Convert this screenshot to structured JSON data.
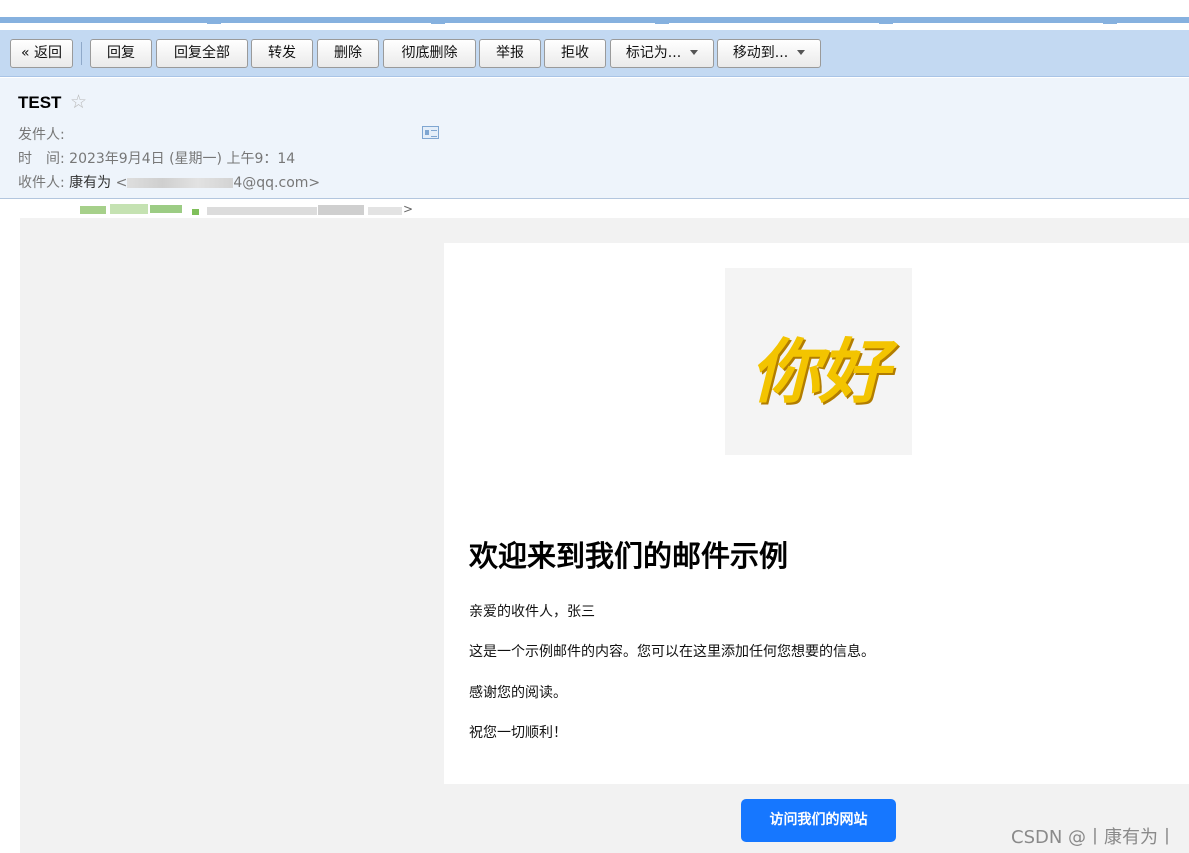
{
  "toolbar": {
    "back": "« 返回",
    "reply": "回复",
    "reply_all": "回复全部",
    "forward": "转发",
    "delete": "删除",
    "delete_forever": "彻底删除",
    "report": "举报",
    "reject": "拒收",
    "mark_as": "标记为...",
    "move_to": "移动到..."
  },
  "header": {
    "subject": "TEST",
    "star": "☆",
    "from_label": "发件人:",
    "time_label": "时　间:",
    "time_value": "2023年9月4日 (星期一) 上午9：14",
    "to_label": "收件人:",
    "to_name": "康有为",
    "to_email_prefix": " <",
    "to_email_visible": "4@qq.com>"
  },
  "email": {
    "logo_text": "你好",
    "title": "欢迎来到我们的邮件示例",
    "greeting": "亲爱的收件人，张三",
    "body": "这是一个示例邮件的内容。您可以在这里添加任何您想要的信息。",
    "thanks": "感谢您的阅读。",
    "closing": "祝您一切顺利！",
    "button": "访问我们的网站"
  },
  "watermark": "CSDN @丨康有为丨",
  "colors": {
    "toolbar_bg": "#c3d9f2",
    "header_bg": "#eef4fb",
    "button_blue": "#1677ff",
    "logo_yellow": "#f3c400"
  }
}
